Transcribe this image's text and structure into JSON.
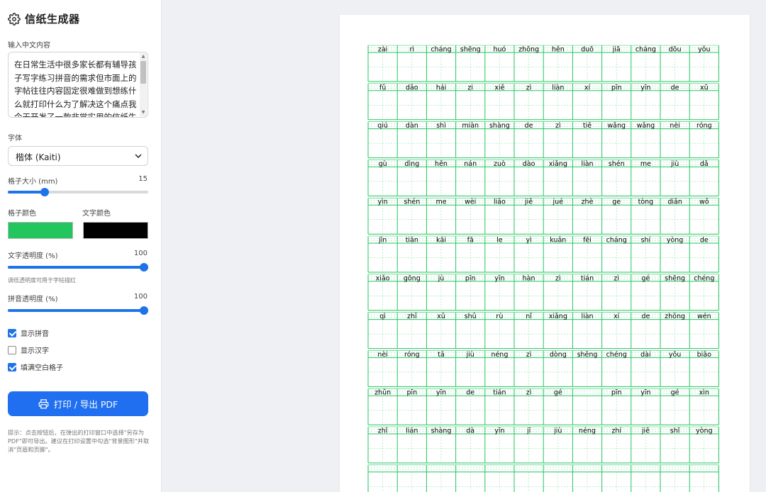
{
  "app": {
    "title": "信纸生成器"
  },
  "input": {
    "label": "输入中文内容",
    "value": "在日常生活中很多家长都有辅导孩子写字练习拼音的需求但市面上的字帖往往内容固定很难做到想练什么就打印什么为了解决这个痛点我今天开发了一款非常实用的信纸生成器"
  },
  "font": {
    "label": "字体",
    "selected": "楷体 (Kaiti)"
  },
  "grid_size": {
    "label": "格子大小 (mm)",
    "value": "15",
    "fraction": 0.265
  },
  "colors": {
    "grid_label": "格子颜色",
    "grid_color": "#22c55e",
    "text_label": "文字颜色",
    "text_color": "#000000",
    "accent": "#1e73e8"
  },
  "text_opacity": {
    "label": "文字透明度 (%)",
    "value": "100",
    "fraction": 1.0,
    "hint": "调低透明度可用于字帖描红"
  },
  "pinyin_opacity": {
    "label": "拼音透明度 (%)",
    "value": "100",
    "fraction": 1.0
  },
  "options": [
    {
      "label": "显示拼音",
      "checked": true
    },
    {
      "label": "显示汉字",
      "checked": false
    },
    {
      "label": "填满空白格子",
      "checked": true
    }
  ],
  "print_button": {
    "label": "打印 / 导出 PDF",
    "icon": "printer-icon"
  },
  "tip": "提示：点击按钮后，在弹出的打印窗口中选择\"另存为 PDF\"即可导出。建议在打印设置中勾选\"背景图形\"并取消\"页眉和页脚\"。",
  "paper": {
    "rows": [
      [
        "zài",
        "rì",
        "cháng",
        "shēng",
        "huó",
        "zhōng",
        "hěn",
        "duō",
        "jiā",
        "cháng",
        "dōu",
        "yǒu"
      ],
      [
        "fǔ",
        "dǎo",
        "hái",
        "zi",
        "xiě",
        "zì",
        "liàn",
        "xí",
        "pīn",
        "yīn",
        "de",
        "xū"
      ],
      [
        "qiú",
        "dàn",
        "shì",
        "miàn",
        "shàng",
        "de",
        "zì",
        "tiē",
        "wǎng",
        "wǎng",
        "nèi",
        "róng"
      ],
      [
        "gù",
        "dìng",
        "hěn",
        "nán",
        "zuò",
        "dào",
        "xiǎng",
        "liàn",
        "shén",
        "me",
        "jiù",
        "dǎ"
      ],
      [
        "yìn",
        "shén",
        "me",
        "wèi",
        "liǎo",
        "jiě",
        "jué",
        "zhè",
        "ge",
        "tòng",
        "diǎn",
        "wǒ"
      ],
      [
        "jīn",
        "tiān",
        "kāi",
        "fā",
        "le",
        "yì",
        "kuǎn",
        "fēi",
        "cháng",
        "shí",
        "yòng",
        "de"
      ],
      [
        "xiǎo",
        "gōng",
        "jù",
        "pīn",
        "yīn",
        "hàn",
        "zì",
        "tián",
        "zì",
        "gé",
        "shēng",
        "chéng"
      ],
      [
        "qì",
        "zhī",
        "xū",
        "shū",
        "rù",
        "nǐ",
        "xiǎng",
        "liàn",
        "xí",
        "de",
        "zhōng",
        "wén"
      ],
      [
        "nèi",
        "róng",
        "tā",
        "jiù",
        "néng",
        "zì",
        "dòng",
        "shēng",
        "chéng",
        "dài",
        "yǒu",
        "biāo"
      ],
      [
        "zhǔn",
        "pīn",
        "yīn",
        "de",
        "tián",
        "zì",
        "gé",
        "",
        "pīn",
        "yīn",
        "gé",
        "xìn"
      ],
      [
        "zhǐ",
        "lián",
        "shàng",
        "dà",
        "yīn",
        "jī",
        "jiù",
        "néng",
        "zhí",
        "jiē",
        "shǐ",
        "yòng"
      ]
    ]
  }
}
